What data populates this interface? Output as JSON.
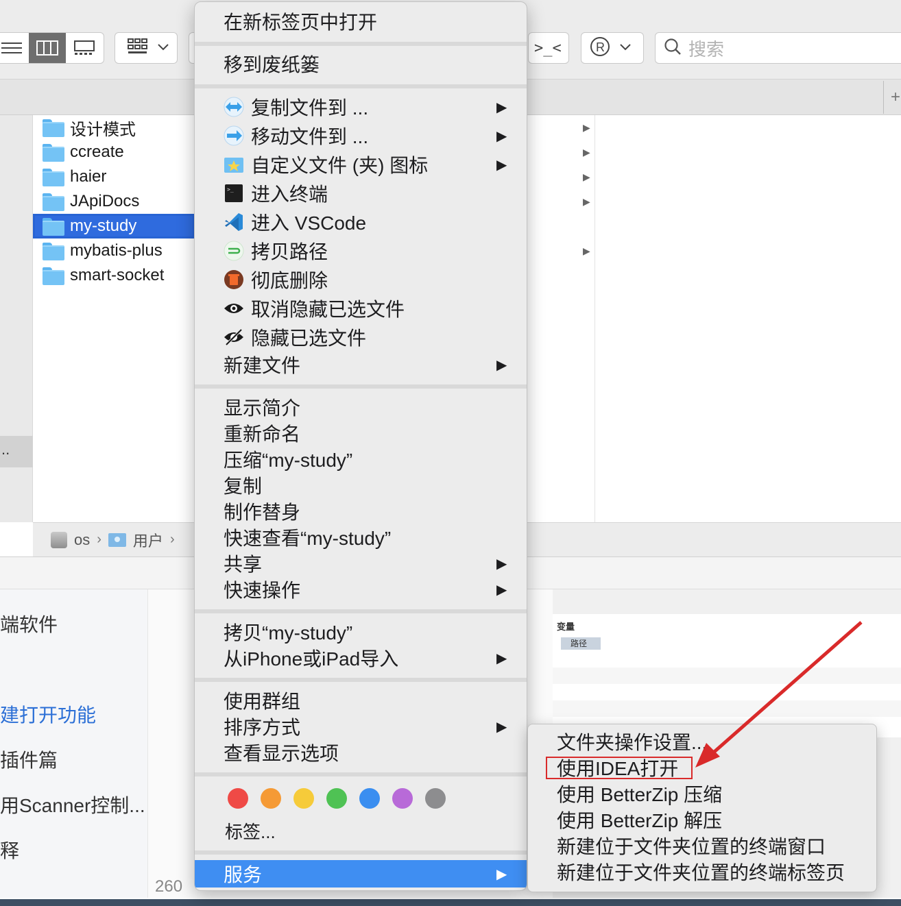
{
  "toolbar": {
    "search_placeholder": "搜索",
    "terminal_glyph": ">_<",
    "view_icons": [
      "list-view-icon",
      "column-view-icon",
      "gallery-view-icon",
      "group-view-icon"
    ]
  },
  "files": [
    {
      "name": "设计模式",
      "selected": false,
      "has_children": true
    },
    {
      "name": "ccreate",
      "selected": false,
      "has_children": true
    },
    {
      "name": "haier",
      "selected": false,
      "has_children": true
    },
    {
      "name": "JApiDocs",
      "selected": false,
      "has_children": true
    },
    {
      "name": "my-study",
      "selected": true,
      "has_children": false
    },
    {
      "name": "mybatis-plus",
      "selected": false,
      "has_children": true
    },
    {
      "name": "smart-socket",
      "selected": false,
      "has_children": false
    }
  ],
  "sidebar": {
    "truncated_label": ".."
  },
  "breadcrumb": {
    "items": [
      "os",
      "用户"
    ]
  },
  "context_menu": {
    "open_new_tab": "在新标签页中打开",
    "move_to_trash": "移到废纸篓",
    "copy_file_to": "复制文件到 ...",
    "move_file_to": "移动文件到 ...",
    "custom_icon": "自定义文件 (夹) 图标",
    "enter_terminal": "进入终端",
    "enter_vscode": "进入 VSCode",
    "copy_path": "拷贝路径",
    "delete_permanently": "彻底删除",
    "unhide_selected": "取消隐藏已选文件",
    "hide_selected": "隐藏已选文件",
    "new_file": "新建文件",
    "get_info": "显示简介",
    "rename": "重新命名",
    "compress": "压缩“my-study”",
    "duplicate": "复制",
    "make_alias": "制作替身",
    "quick_look": "快速查看“my-study”",
    "share": "共享",
    "quick_actions": "快速操作",
    "copy_item": "拷贝“my-study”",
    "import_iphone": "从iPhone或iPad导入",
    "use_groups": "使用群组",
    "sort_by": "排序方式",
    "view_options": "查看显示选项",
    "tags_label": "标签...",
    "services": "服务",
    "tag_colors": [
      "#ef4a46",
      "#f59a35",
      "#f6cb3a",
      "#4fc254",
      "#3a8ef0",
      "#b86ad8",
      "#8d8d8f"
    ]
  },
  "services_menu": {
    "items": [
      "文件夹操作设置...",
      "使用IDEA打开",
      "使用 BetterZip 压缩",
      "使用 BetterZip 解压",
      "新建位于文件夹位置的终端窗口",
      "新建位于文件夹位置的终端标签页"
    ]
  },
  "background_window": {
    "left_items": [
      "端软件",
      "建打开功能",
      "插件篇",
      "用Scanner控制...",
      "释"
    ],
    "page_count": "260",
    "variables_title": "变量",
    "variables_chip": "路径"
  },
  "annotation": {
    "color": "#d92a2a"
  }
}
